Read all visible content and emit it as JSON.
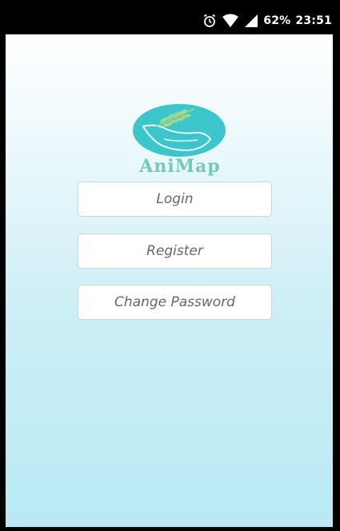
{
  "status_bar": {
    "icons": [
      "alarm-icon",
      "wifi-icon",
      "signal-icon"
    ],
    "battery": "62%",
    "time": "23:51"
  },
  "logo": {
    "text": "AniMap",
    "colors": {
      "ellipse": "#3cc6cc",
      "text": "#74c9b7",
      "leaves": "#8fcf7a"
    }
  },
  "buttons": {
    "login": "Login",
    "register": "Register",
    "change_password": "Change Password"
  },
  "colors": {
    "background_top": "#ffffff",
    "background_bottom": "#b8e9f5",
    "button_text": "#666666"
  }
}
